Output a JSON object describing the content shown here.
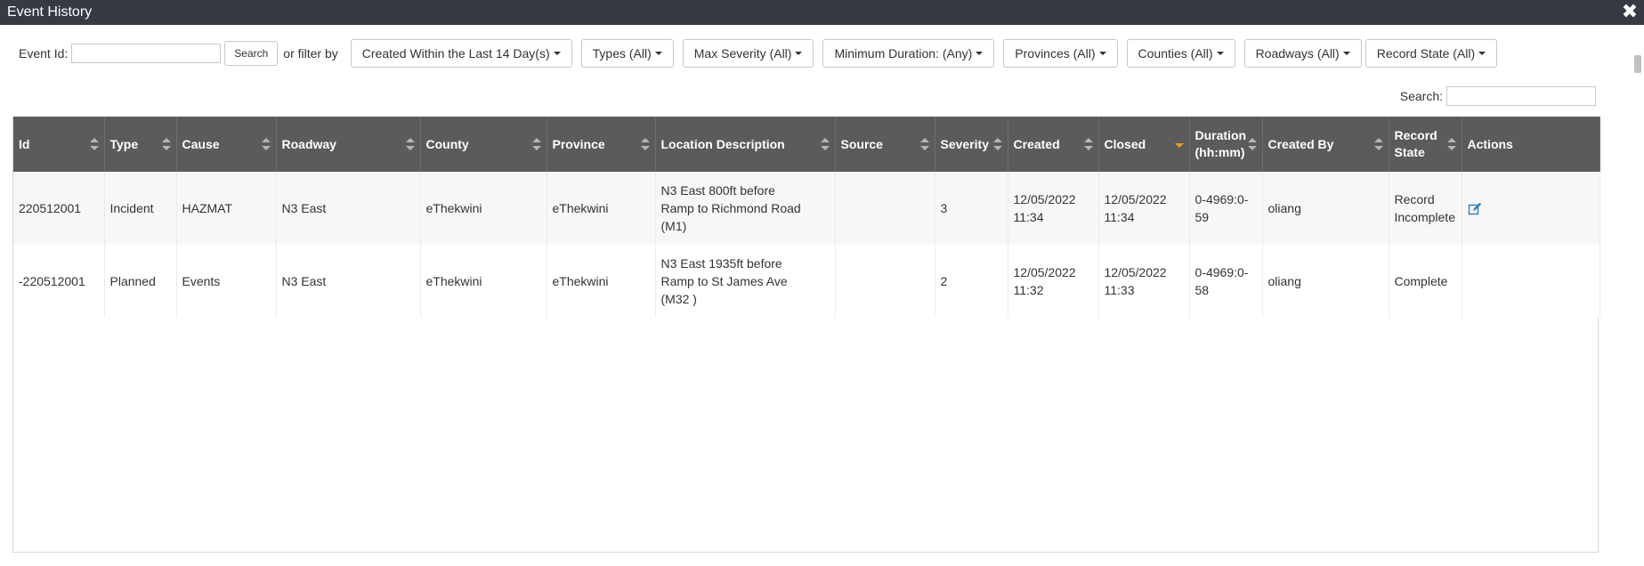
{
  "window": {
    "title": "Event History"
  },
  "filters": {
    "event_id_label": "Event Id:",
    "event_id_value": "",
    "search_button": "Search",
    "or_filter_by": "or filter by",
    "dropdowns": [
      "Created Within the Last 14 Day(s)",
      "Types (All)",
      "Max Severity (All)",
      "Minimum Duration: (Any)",
      "Provinces (All)",
      "Counties (All)",
      "Roadways (All)",
      "Record State (All)"
    ]
  },
  "table_search": {
    "label": "Search:",
    "value": ""
  },
  "columns": [
    {
      "label": "Id",
      "sort": "both"
    },
    {
      "label": "Type",
      "sort": "both"
    },
    {
      "label": "Cause",
      "sort": "both"
    },
    {
      "label": "Roadway",
      "sort": "both"
    },
    {
      "label": "County",
      "sort": "both"
    },
    {
      "label": "Province",
      "sort": "both"
    },
    {
      "label": "Location Description",
      "sort": "both"
    },
    {
      "label": "Source",
      "sort": "both"
    },
    {
      "label": "Severity",
      "sort": "both"
    },
    {
      "label": "Created",
      "sort": "both"
    },
    {
      "label": "Closed",
      "sort": "desc"
    },
    {
      "label": "Duration (hh:mm)",
      "sort": "both"
    },
    {
      "label": "Created By",
      "sort": "both"
    },
    {
      "label": "Record State",
      "sort": "both"
    },
    {
      "label": "Actions",
      "sort": "none"
    }
  ],
  "rows": [
    {
      "id": "220512001",
      "type": "Incident",
      "cause": "HAZMAT",
      "roadway": "N3 East",
      "county": "eThekwini",
      "province": "eThekwini",
      "location": "N3 East 800ft before Ramp to Richmond Road (M1)",
      "source": "",
      "severity": "3",
      "created": "12/05/2022 11:34",
      "closed": "12/05/2022 11:34",
      "duration": "0-4969:0-59",
      "created_by": "oliang",
      "record_state": "Record Incomplete",
      "action": "edit-icon"
    },
    {
      "id": "-220512001",
      "type": "Planned",
      "cause": "Events",
      "roadway": "N3 East",
      "county": "eThekwini",
      "province": "eThekwini",
      "location": "N3 East 1935ft before Ramp to St James Ave (M32 )",
      "source": "",
      "severity": "2",
      "created": "12/05/2022 11:32",
      "closed": "12/05/2022 11:33",
      "duration": "0-4969:0-58",
      "created_by": "oliang",
      "record_state": "Complete",
      "action": ""
    }
  ],
  "colors": {
    "titlebar": "#353a44",
    "header": "#5b5b5b",
    "sort_active": "#f39c12",
    "edit_icon": "#2f7fc1"
  }
}
